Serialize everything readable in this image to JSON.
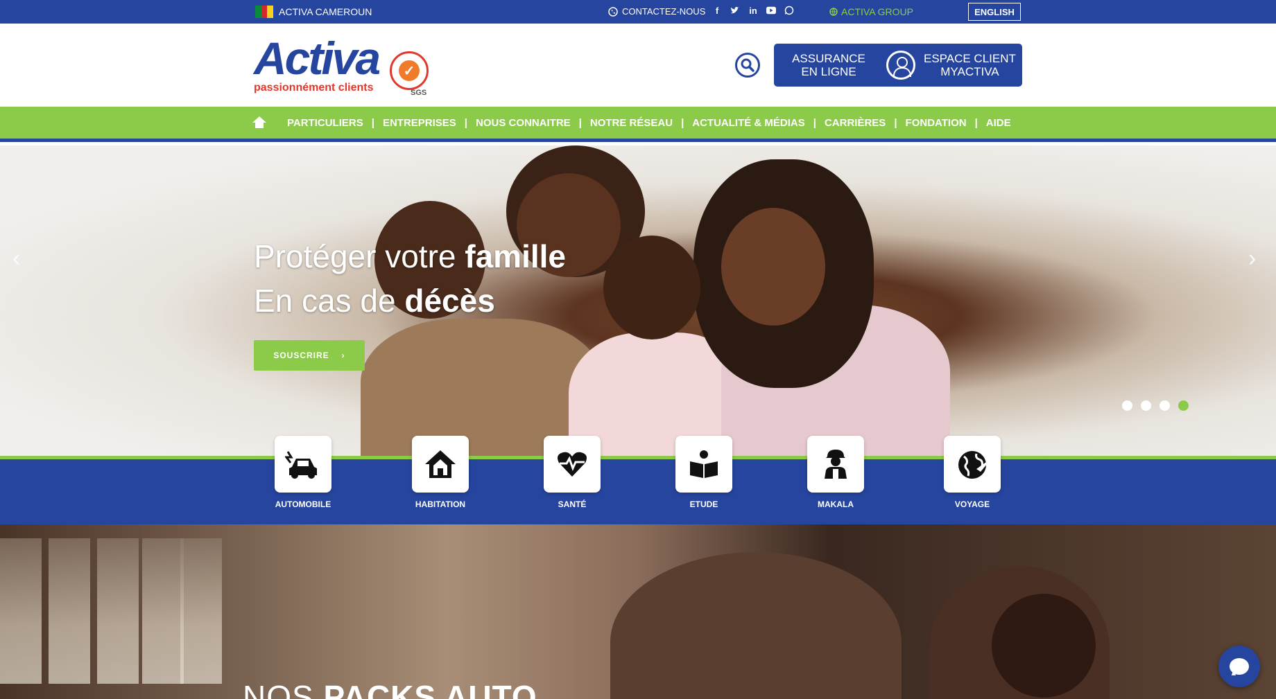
{
  "topbar": {
    "country_label": "ACTIVA CAMEROUN",
    "contact_label": "CONTACTEZ-NOUS",
    "socials": [
      "facebook-icon",
      "twitter-icon",
      "linkedin-icon",
      "youtube-icon",
      "whatsapp-icon"
    ],
    "group_label": "ACTIVA GROUP",
    "english_label": "ENGLISH"
  },
  "header": {
    "logo_word": "Activa",
    "logo_tagline": "passionnément clients",
    "cert_label": "SGS",
    "assurance_line1": "ASSURANCE",
    "assurance_line2": "EN LIGNE",
    "espace_line1": "ESPACE CLIENT",
    "espace_line2": "MYACTIVA"
  },
  "nav": {
    "items": [
      "PARTICULIERS",
      "ENTREPRISES",
      "NOUS CONNAITRE",
      "NOTRE RÉSEAU",
      "ACTUALITÉ & MÉDIAS",
      "CARRIÈRES",
      "FONDATION",
      "AIDE"
    ]
  },
  "hero": {
    "line1_light": "Protéger votre",
    "line1_bold": "famille",
    "line2_light": "En cas de",
    "line2_bold": "décès",
    "button_label": "SOUSCRIRE",
    "slide_count": 4,
    "active_slide": 4
  },
  "categories": [
    {
      "label": "AUTOMOBILE",
      "icon": "car-crash-icon"
    },
    {
      "label": "HABITATION",
      "icon": "house-icon"
    },
    {
      "label": "SANTÉ",
      "icon": "heartbeat-icon"
    },
    {
      "label": "ETUDE",
      "icon": "reading-icon"
    },
    {
      "label": "MAKALA",
      "icon": "worker-icon"
    },
    {
      "label": "VOYAGE",
      "icon": "globe-plane-icon"
    }
  ],
  "bottom": {
    "title_light": "NOS",
    "title_bold": "PACKS AUTO"
  },
  "colors": {
    "brand_blue": "#26459e",
    "brand_green": "#8ccb49",
    "brand_red": "#e2372a"
  }
}
